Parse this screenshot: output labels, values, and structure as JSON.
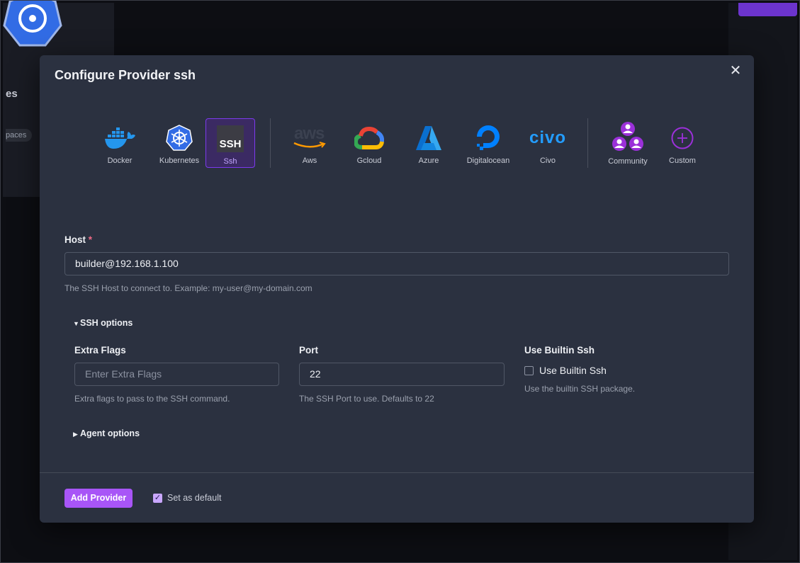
{
  "background": {
    "sidebar_label": "es",
    "sidebar_chip": "paces"
  },
  "modal": {
    "title": "Configure Provider ssh",
    "close_symbol": "✕"
  },
  "providers": [
    {
      "label": "Docker",
      "icon": "docker-icon",
      "selected": false
    },
    {
      "label": "Kubernetes",
      "icon": "kubernetes-icon",
      "selected": false
    },
    {
      "label": "Ssh",
      "icon": "ssh-icon",
      "icon_text": "SSH",
      "selected": true
    },
    {
      "label": "Aws",
      "icon": "aws-icon",
      "icon_text": "aws",
      "selected": false
    },
    {
      "label": "Gcloud",
      "icon": "gcloud-icon",
      "selected": false
    },
    {
      "label": "Azure",
      "icon": "azure-icon",
      "selected": false
    },
    {
      "label": "Digitalocean",
      "icon": "digitalocean-icon",
      "selected": false
    },
    {
      "label": "Civo",
      "icon": "civo-icon",
      "icon_text": "civo",
      "selected": false
    },
    {
      "label": "Community",
      "icon": "community-icon",
      "selected": false
    },
    {
      "label": "Custom",
      "icon": "plus-circle-icon",
      "selected": false
    }
  ],
  "form": {
    "host": {
      "label": "Host",
      "required_mark": "*",
      "value": "builder@192.168.1.100",
      "help": "The SSH Host to connect to. Example: my-user@my-domain.com"
    },
    "ssh_options": {
      "toggle_label": "SSH options",
      "expanded": true,
      "extra_flags": {
        "label": "Extra Flags",
        "value": "",
        "placeholder": "Enter Extra Flags",
        "help": "Extra flags to pass to the SSH command."
      },
      "port": {
        "label": "Port",
        "value": "22",
        "help": "The SSH Port to use. Defaults to 22"
      },
      "use_builtin_ssh": {
        "label": "Use Builtin Ssh",
        "checkbox_label": "Use Builtin Ssh",
        "checked": false,
        "help": "Use the builtin SSH package."
      }
    },
    "agent_options": {
      "toggle_label": "Agent options",
      "expanded": false
    }
  },
  "footer": {
    "add_button": "Add Provider",
    "set_default_label": "Set as default",
    "set_default_checked": true
  },
  "colors": {
    "accent": "#a855f7",
    "modal_bg": "#2b3140",
    "selected_bg": "#3b2a63",
    "required": "#f06a86"
  }
}
